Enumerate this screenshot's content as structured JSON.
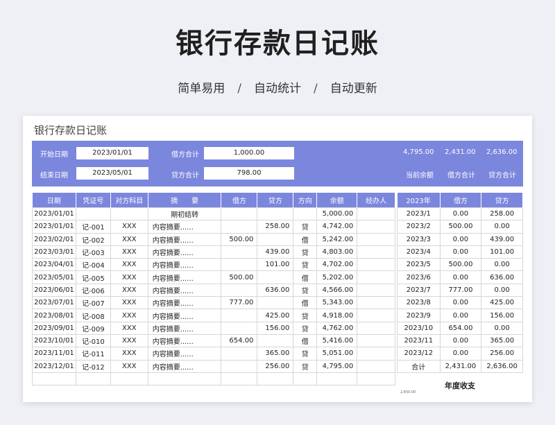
{
  "header": {
    "title": "银行存款日记账",
    "subtitle_items": [
      "简单易用",
      "自动统计",
      "自动更新"
    ],
    "separator": "/"
  },
  "sheet": {
    "title": "银行存款日记账",
    "start_label": "开始日期",
    "start_value": "2023/01/01",
    "end_label": "结束日期",
    "end_value": "2023/05/01",
    "debit_total_label": "借方合计",
    "debit_total_value": "1,000.00",
    "credit_total_label": "贷方合计",
    "credit_total_value": "798.00",
    "summary_values": [
      "4,795.00",
      "2,431.00",
      "2,636.00"
    ],
    "summary_labels": [
      "当前余额",
      "借方合计",
      "贷方合计"
    ]
  },
  "ledger": {
    "columns": [
      "日期",
      "凭证号",
      "对方科目",
      "摘　　要",
      "借方",
      "贷方",
      "方向",
      "余额",
      "经办人"
    ],
    "rows": [
      [
        "2023/01/01",
        "",
        "",
        "期初结转",
        "",
        "",
        "",
        "5,000.00",
        ""
      ],
      [
        "2023/01/01",
        "记-001",
        "XXX",
        "内容摘要......",
        "",
        "258.00",
        "贷",
        "4,742.00",
        ""
      ],
      [
        "2023/02/01",
        "记-002",
        "XXX",
        "内容摘要......",
        "500.00",
        "",
        "借",
        "5,242.00",
        ""
      ],
      [
        "2023/03/01",
        "记-003",
        "XXX",
        "内容摘要......",
        "",
        "439.00",
        "贷",
        "4,803.00",
        ""
      ],
      [
        "2023/04/01",
        "记-004",
        "XXX",
        "内容摘要......",
        "",
        "101.00",
        "贷",
        "4,702.00",
        ""
      ],
      [
        "2023/05/01",
        "记-005",
        "XXX",
        "内容摘要......",
        "500.00",
        "",
        "借",
        "5,202.00",
        ""
      ],
      [
        "2023/06/01",
        "记-006",
        "XXX",
        "内容摘要......",
        "",
        "636.00",
        "贷",
        "4,566.00",
        ""
      ],
      [
        "2023/07/01",
        "记-007",
        "XXX",
        "内容摘要......",
        "777.00",
        "",
        "借",
        "5,343.00",
        ""
      ],
      [
        "2023/08/01",
        "记-008",
        "XXX",
        "内容摘要......",
        "",
        "425.00",
        "贷",
        "4,918.00",
        ""
      ],
      [
        "2023/09/01",
        "记-009",
        "XXX",
        "内容摘要......",
        "",
        "156.00",
        "贷",
        "4,762.00",
        ""
      ],
      [
        "2023/10/01",
        "记-010",
        "XXX",
        "内容摘要......",
        "654.00",
        "",
        "借",
        "5,416.00",
        ""
      ],
      [
        "2023/11/01",
        "记-011",
        "XXX",
        "内容摘要......",
        "",
        "365.00",
        "贷",
        "5,051.00",
        ""
      ],
      [
        "2023/12/01",
        "记-012",
        "XXX",
        "内容摘要......",
        "",
        "256.00",
        "贷",
        "4,795.00",
        ""
      ],
      [
        "",
        "",
        "",
        "",
        "",
        "",
        "",
        "",
        ""
      ]
    ]
  },
  "yearly": {
    "columns": [
      "2023年",
      "借方",
      "贷方"
    ],
    "rows": [
      [
        "2023/1",
        "0.00",
        "258.00"
      ],
      [
        "2023/2",
        "500.00",
        "0.00"
      ],
      [
        "2023/3",
        "0.00",
        "439.00"
      ],
      [
        "2023/4",
        "0.00",
        "101.00"
      ],
      [
        "2023/5",
        "500.00",
        "0.00"
      ],
      [
        "2023/6",
        "0.00",
        "636.00"
      ],
      [
        "2023/7",
        "777.00",
        "0.00"
      ],
      [
        "2023/8",
        "0.00",
        "425.00"
      ],
      [
        "2023/9",
        "0.00",
        "156.00"
      ],
      [
        "2023/10",
        "654.00",
        "0.00"
      ],
      [
        "2023/11",
        "0.00",
        "365.00"
      ],
      [
        "2023/12",
        "0.00",
        "256.00"
      ],
      [
        "合计",
        "2,431.00",
        "2,636.00"
      ]
    ],
    "chart_title": "年度收支",
    "chart_tick": "2,650.00"
  },
  "colors": {
    "accent": "#7b86dd",
    "background": "#eef0f5"
  }
}
